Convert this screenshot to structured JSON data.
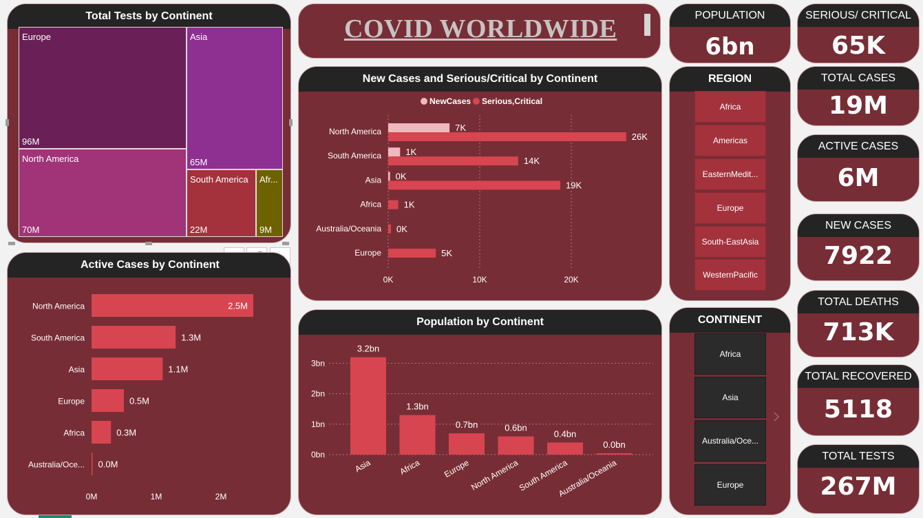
{
  "title": "COVID WORLDWIDE",
  "kpis": {
    "population": {
      "label": "POPULATION",
      "value": "6bn"
    },
    "serious_critical": {
      "label": "SERIOUS/ CRITICAL",
      "value": "65K"
    },
    "total_cases": {
      "label": "TOTAL CASES",
      "value": "19M"
    },
    "active_cases": {
      "label": "ACTIVE CASES",
      "value": "6M"
    },
    "new_cases": {
      "label": "NEW CASES",
      "value": "7922"
    },
    "total_deaths": {
      "label": "TOTAL DEATHS",
      "value": "713K"
    },
    "total_recovered": {
      "label": "TOTAL RECOVERED",
      "value": "5118"
    },
    "total_tests": {
      "label": "TOTAL TESTS",
      "value": "267M"
    }
  },
  "region_slicer": {
    "title": "REGION",
    "items": [
      "Africa",
      "Americas",
      "EasternMedit...",
      "Europe",
      "South-EastAsia",
      "WesternPacific"
    ]
  },
  "continent_slicer": {
    "title": "CONTINENT",
    "items": [
      "Africa",
      "Asia",
      "Australia/Oce...",
      "Europe"
    ]
  },
  "colors": {
    "background": "#772d35",
    "header": "#242424",
    "bar": "#d64550",
    "bar_light": "#f0b8bf",
    "slicer_item": "#a3323c",
    "treemap_europe": "#6b1f57",
    "treemap_asia": "#8e2f92",
    "treemap_north_america": "#a13378",
    "treemap_south_america": "#a3323c",
    "treemap_africa": "#6e6200"
  },
  "chart_data": [
    {
      "id": "treemap",
      "type": "treemap",
      "title": "Total Tests by Continent",
      "labels": [
        "Europe",
        "North America",
        "Asia",
        "South America",
        "Afr..."
      ],
      "value_labels": [
        "96M",
        "70M",
        "65M",
        "22M",
        "9M"
      ],
      "values": [
        96,
        70,
        65,
        22,
        9
      ],
      "unit": "M"
    },
    {
      "id": "active",
      "type": "bar",
      "orientation": "horizontal",
      "title": "Active Cases by Continent",
      "categories": [
        "North America",
        "South America",
        "Asia",
        "Europe",
        "Africa",
        "Australia/Oce..."
      ],
      "values": [
        2.5,
        1.3,
        1.1,
        0.5,
        0.3,
        0.0
      ],
      "value_labels": [
        "2.5M",
        "1.3M",
        "1.1M",
        "0.5M",
        "0.3M",
        "0.0M"
      ],
      "xlim": [
        0,
        3.0
      ],
      "ticks": [
        0,
        1,
        2
      ],
      "tick_labels": [
        "0M",
        "1M",
        "2M"
      ]
    },
    {
      "id": "newcases",
      "type": "bar",
      "orientation": "horizontal",
      "title": "New Cases and Serious/Critical by Continent",
      "categories": [
        "North America",
        "South America",
        "Asia",
        "Africa",
        "Australia/Oceania",
        "Europe"
      ],
      "series": [
        {
          "name": "NewCases",
          "values": [
            6.7,
            1.3,
            0.2,
            0.0,
            0.0,
            0.0
          ],
          "labels": [
            "7K",
            "1K",
            "0K",
            "",
            "",
            ""
          ]
        },
        {
          "name": "Serious,Critical",
          "values": [
            26,
            14.2,
            18.8,
            1.1,
            0.3,
            5.2
          ],
          "labels": [
            "26K",
            "14K",
            "19K",
            "1K",
            "0K",
            "5K"
          ]
        }
      ],
      "xlim": [
        0,
        27
      ],
      "ticks": [
        0,
        10,
        20
      ],
      "tick_labels": [
        "0K",
        "10K",
        "20K"
      ],
      "legend": "top-center"
    },
    {
      "id": "population",
      "type": "bar",
      "title": "Population by Continent",
      "categories": [
        "Asia",
        "Africa",
        "Europe",
        "North America",
        "South America",
        "Australia/Oceania"
      ],
      "values": [
        3.2,
        1.3,
        0.7,
        0.6,
        0.4,
        0.04
      ],
      "value_labels": [
        "3.2bn",
        "1.3bn",
        "0.7bn",
        "0.6bn",
        "0.4bn",
        "0.0bn"
      ],
      "ylim": [
        0,
        3.5
      ],
      "ticks": [
        0,
        1,
        2,
        3
      ],
      "tick_labels": [
        "0bn",
        "1bn",
        "2bn",
        "3bn"
      ],
      "grid": true
    }
  ]
}
